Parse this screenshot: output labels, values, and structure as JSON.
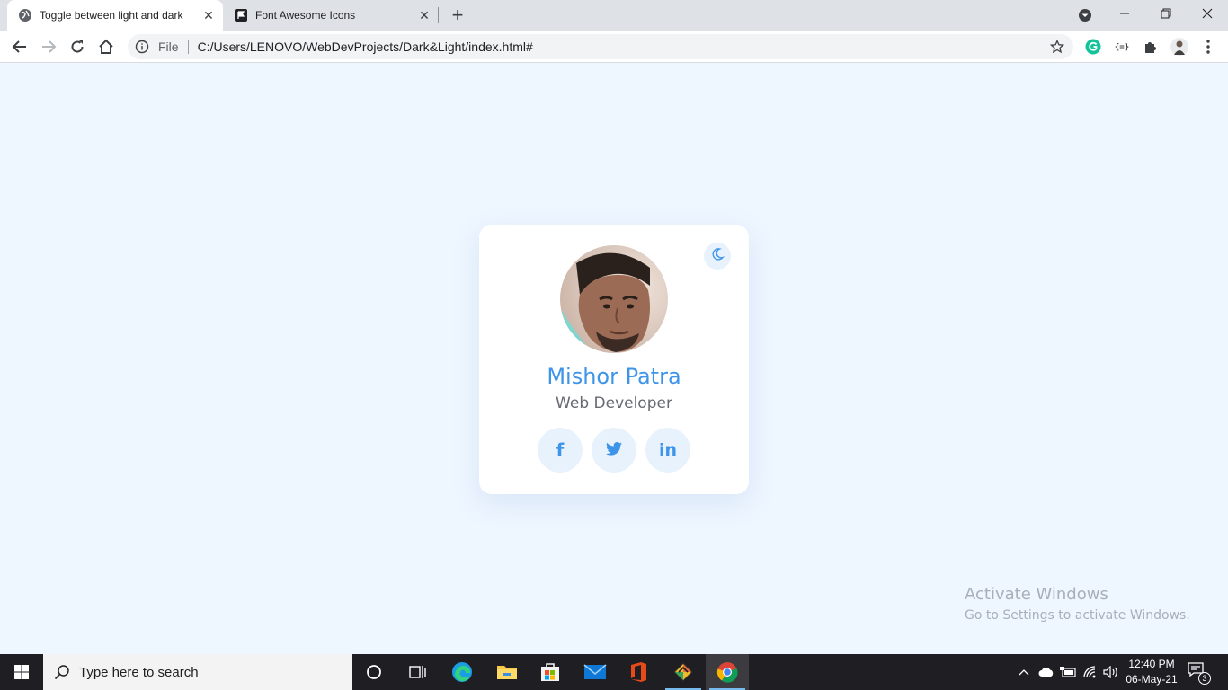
{
  "browser": {
    "tabs": [
      {
        "title": "Toggle between light and dark",
        "active": true,
        "icon": "globe-icon"
      },
      {
        "title": "Font Awesome Icons",
        "active": false,
        "icon": "flag-icon"
      }
    ],
    "omnibox": {
      "scheme_label": "File",
      "url": "C:/Users/LENOVO/WebDevProjects/Dark&Light/index.html#"
    }
  },
  "profile_card": {
    "name": "Mishor Patra",
    "role": "Web Developer",
    "social_links": [
      "facebook",
      "twitter",
      "linkedin"
    ],
    "toggle_icon": "moon-icon",
    "accent_color": "#3d94e8"
  },
  "watermark": {
    "title": "Activate Windows",
    "subtitle": "Go to Settings to activate Windows."
  },
  "taskbar": {
    "search_placeholder": "Type here to search",
    "time": "12:40 PM",
    "date": "06-May-21",
    "notification_count": "3"
  }
}
